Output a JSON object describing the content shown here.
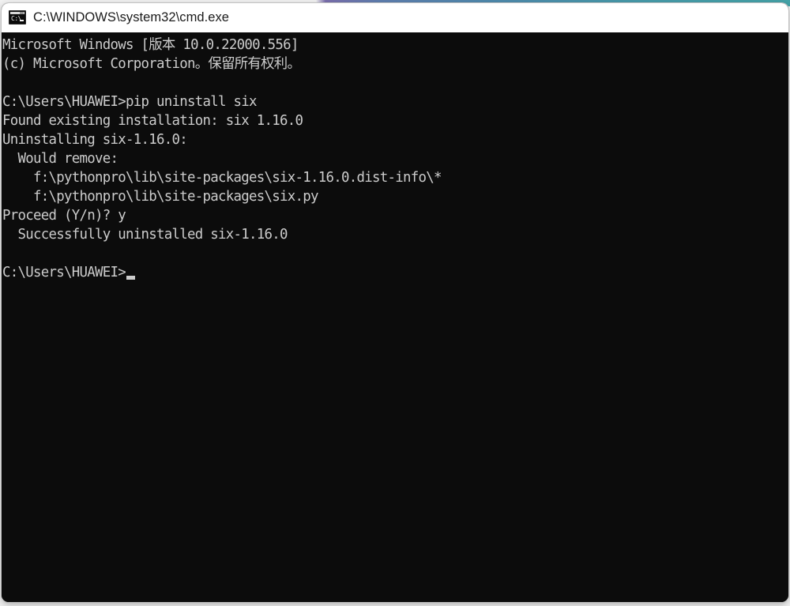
{
  "window": {
    "title": "C:\\WINDOWS\\system32\\cmd.exe",
    "icon": "cmd-console-icon",
    "icon_text": "C:\\",
    "bg_color": "#0c0c0c",
    "fg_color": "#cccccc",
    "titlebar_color": "#ffffff",
    "titlebar_text_color": "#1b1b1b"
  },
  "console": {
    "prompt": "C:\\Users\\HUAWEI>",
    "cursor": "block-underscore",
    "lines": [
      "Microsoft Windows [版本 10.0.22000.556]",
      "(c) Microsoft Corporation。保留所有权利。",
      "",
      "C:\\Users\\HUAWEI>pip uninstall six",
      "Found existing installation: six 1.16.0",
      "Uninstalling six-1.16.0:",
      "  Would remove:",
      "    f:\\pythonpro\\lib\\site-packages\\six-1.16.0.dist-info\\*",
      "    f:\\pythonpro\\lib\\site-packages\\six.py",
      "Proceed (Y/n)? y",
      "  Successfully uninstalled six-1.16.0",
      "",
      "C:\\Users\\HUAWEI>"
    ]
  }
}
